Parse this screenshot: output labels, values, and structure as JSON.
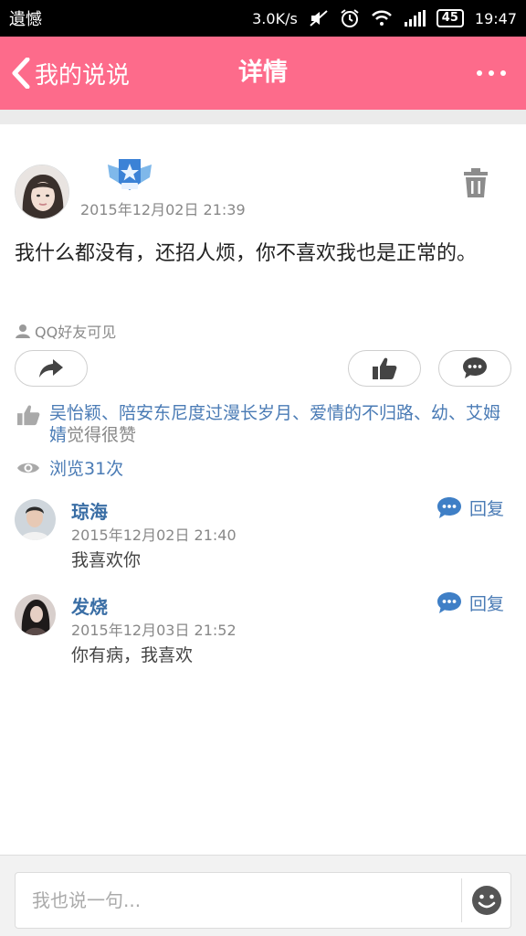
{
  "status_bar": {
    "carrier": "遺憾",
    "speed": "3.0K/s",
    "battery": "45",
    "time": "19:47"
  },
  "nav": {
    "back_label": "我的说说",
    "title": "详情"
  },
  "post": {
    "time": "2015年12月02日 21:39",
    "text": "我什么都没有，还招人烦，你不喜欢我也是正常的。",
    "visibility": "QQ好友可见",
    "likes_names": "吴怡颖、陪安东尼度过漫长岁月、爱情的不归路、幼、艾姆婧",
    "likes_suffix": "觉得很赞",
    "views": "浏览31次"
  },
  "comments": [
    {
      "name": "琼海",
      "time": "2015年12月02日 21:40",
      "text": "我喜欢你",
      "reply_label": "回复"
    },
    {
      "name": "发烧",
      "time": "2015年12月03日 21:52",
      "text": "你有病，我喜欢",
      "reply_label": "回复"
    }
  ],
  "input": {
    "placeholder": "我也说一句..."
  },
  "colors": {
    "header": "#fd6b8b",
    "link": "#4a7bb5"
  }
}
